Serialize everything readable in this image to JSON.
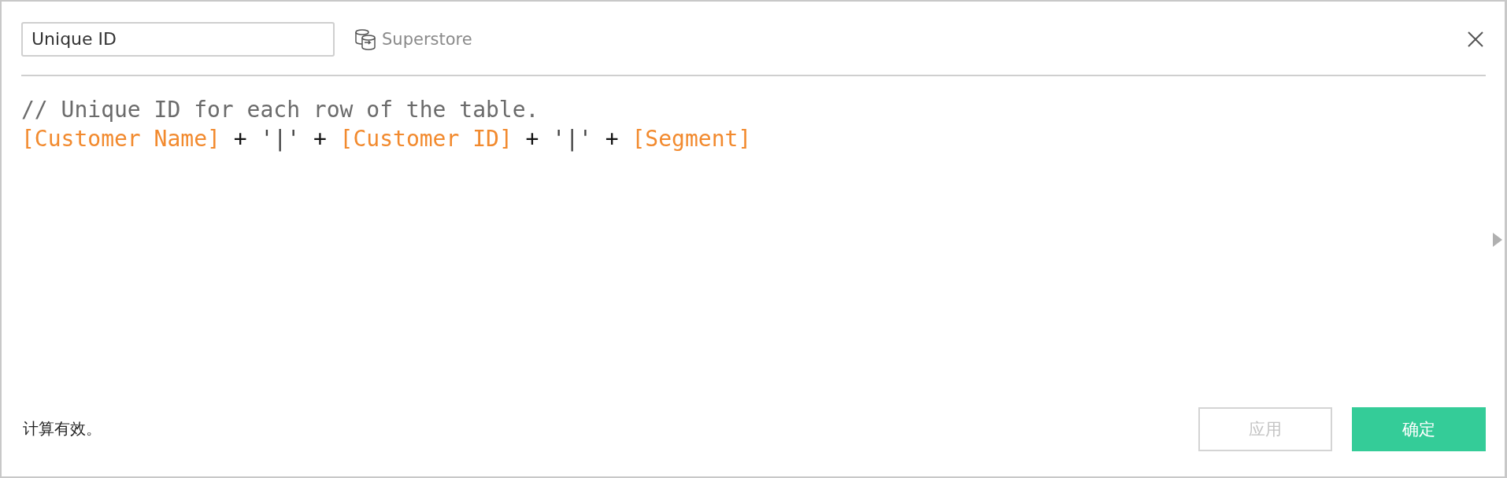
{
  "name_field": {
    "value": "Unique ID"
  },
  "data_source": {
    "label": "Superstore"
  },
  "code_lines": [
    {
      "tokens": [
        {
          "kind": "comment",
          "text": "// Unique ID for each row of the table."
        }
      ]
    },
    {
      "tokens": [
        {
          "kind": "field",
          "text": "[Customer Name]"
        },
        {
          "kind": "operator",
          "text": " + "
        },
        {
          "kind": "string",
          "text": "'|'"
        },
        {
          "kind": "operator",
          "text": " + "
        },
        {
          "kind": "field",
          "text": "[Customer ID]"
        },
        {
          "kind": "operator",
          "text": " + "
        },
        {
          "kind": "string",
          "text": "'|'"
        },
        {
          "kind": "operator",
          "text": " + "
        },
        {
          "kind": "field",
          "text": "[Segment]"
        }
      ]
    }
  ],
  "status": "计算有效。",
  "buttons": [
    {
      "label": "应用",
      "kind": "secondary",
      "disabled": true
    },
    {
      "label": "确定",
      "kind": "primary",
      "disabled": false
    }
  ]
}
